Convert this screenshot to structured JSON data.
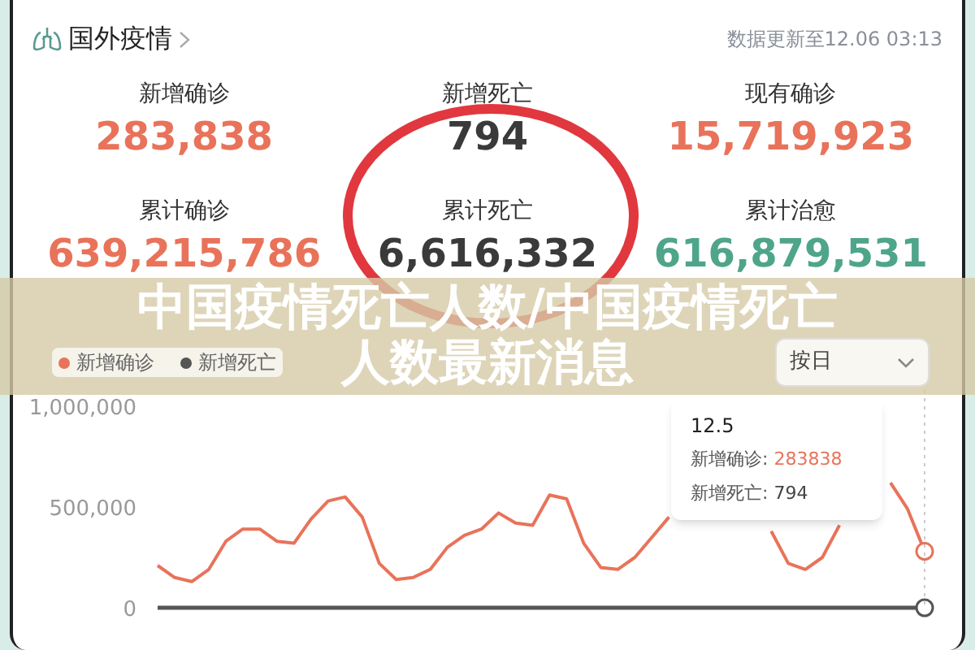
{
  "header": {
    "title": "国外疫情",
    "updated": "数据更新至12.06 03:13"
  },
  "stats": [
    {
      "label": "新增确诊",
      "value": "283,838",
      "color": "#e8735a"
    },
    {
      "label": "新增死亡",
      "value": "794",
      "color": "#3a3a3a"
    },
    {
      "label": "现有确诊",
      "value": "15,719,923",
      "color": "#e8735a"
    },
    {
      "label": "累计确诊",
      "value": "639,215,786",
      "color": "#e8735a"
    },
    {
      "label": "累计死亡",
      "value": "6,616,332",
      "color": "#3a3a3a"
    },
    {
      "label": "累计治愈",
      "value": "616,879,531",
      "color": "#4fa58a"
    }
  ],
  "period_select": {
    "value": "按日"
  },
  "chart": {
    "chart_data": {
      "type": "line",
      "ylim": [
        0,
        1000000
      ],
      "yticks": [
        {
          "value": 0,
          "label": "0"
        },
        {
          "value": 500000,
          "label": "500,000"
        },
        {
          "value": 1000000,
          "label": "1,000,000"
        }
      ],
      "series": [
        {
          "name": "新增确诊",
          "color": "#e8735a",
          "values": [
            210000,
            150000,
            130000,
            190000,
            330000,
            390000,
            390000,
            330000,
            320000,
            440000,
            530000,
            550000,
            450000,
            220000,
            140000,
            150000,
            190000,
            300000,
            360000,
            390000,
            470000,
            420000,
            410000,
            560000,
            540000,
            320000,
            200000,
            190000,
            250000,
            350000,
            450000,
            null,
            null,
            null,
            null,
            null,
            380000,
            220000,
            190000,
            250000,
            410000,
            null,
            null,
            620000,
            490000,
            280000
          ]
        },
        {
          "name": "新增死亡",
          "color": "#555555",
          "values": [
            0,
            0,
            0,
            0,
            0,
            0,
            0,
            0,
            0,
            0,
            0,
            0,
            0,
            0,
            0,
            0,
            0,
            0,
            0,
            0,
            0,
            0,
            0,
            0,
            0,
            0,
            0,
            0,
            0,
            0,
            0,
            0,
            0,
            0,
            0,
            0,
            0,
            0,
            0,
            0,
            0,
            0,
            0,
            0,
            0,
            0
          ]
        }
      ]
    }
  },
  "tooltip": {
    "date": "12.5",
    "rows": [
      {
        "label": "新增确诊:",
        "value": "283838",
        "color": "#e8735a"
      },
      {
        "label": "新增死亡:",
        "value": "794",
        "color": "#444444"
      }
    ]
  },
  "banner": {
    "lines": [
      "中国疫情死亡人数/中国疫情死亡",
      "人数最新消息"
    ]
  }
}
